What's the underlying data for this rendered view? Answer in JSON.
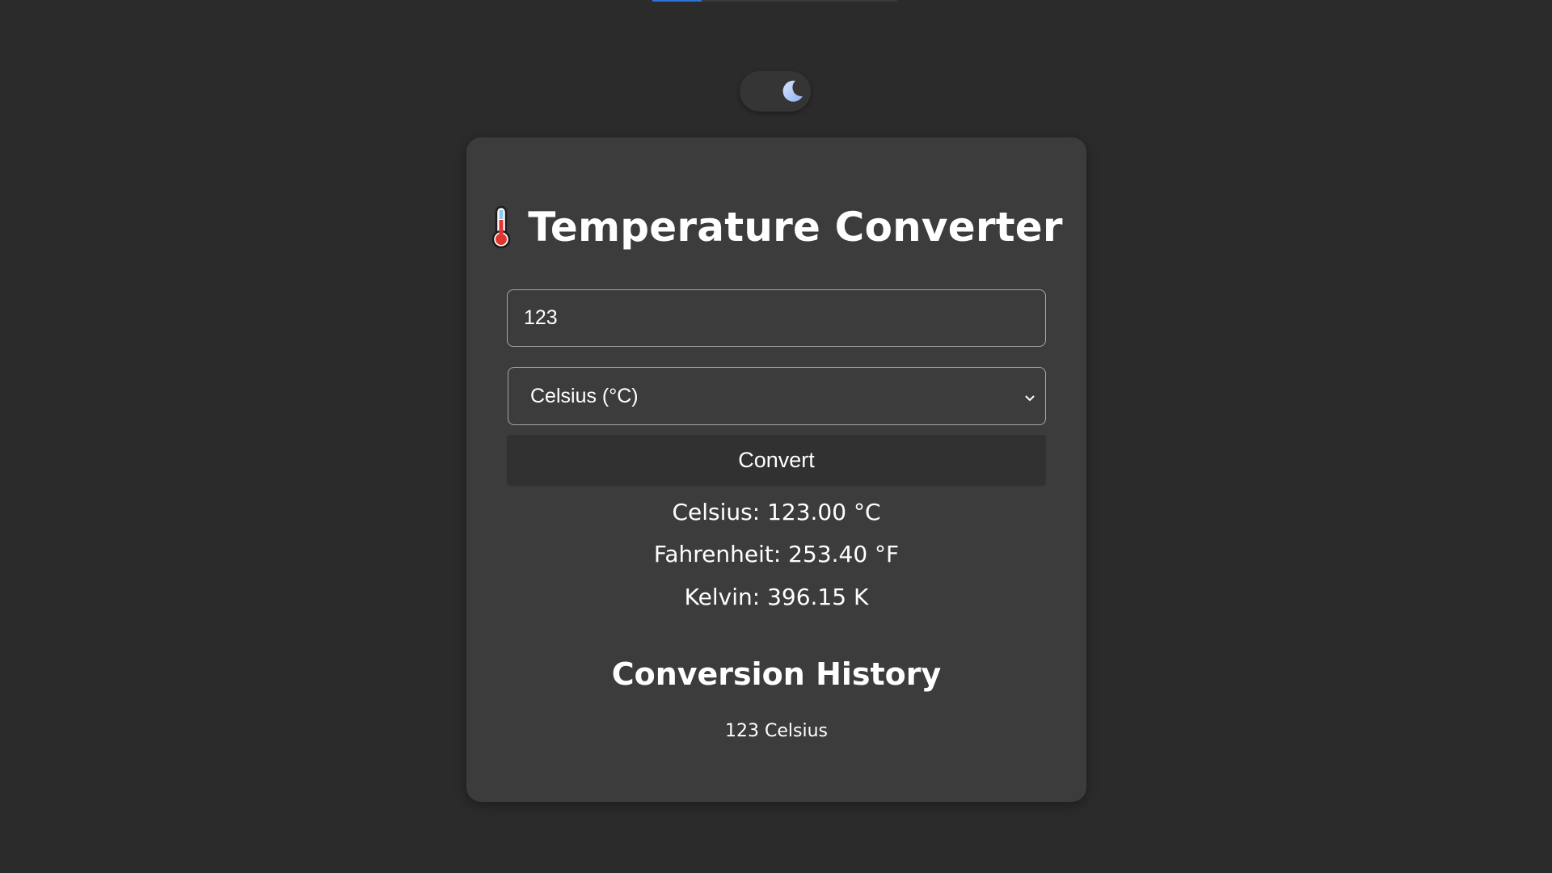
{
  "theme_toggle": {
    "icon": "moon-icon",
    "mode": "dark"
  },
  "top_progress": {
    "fraction": 0.2
  },
  "header": {
    "icon": "thermometer-icon",
    "title": "Temperature Converter"
  },
  "form": {
    "input_value": "123",
    "unit_selected": "Celsius (°C)",
    "convert_label": "Convert"
  },
  "results": {
    "celsius": "Celsius: 123.00 °C",
    "fahrenheit": "Fahrenheit: 253.40 °F",
    "kelvin": "Kelvin: 396.15 K"
  },
  "history": {
    "title": "Conversion History",
    "items": [
      "123 Celsius"
    ]
  },
  "colors": {
    "background": "#2b2b2b",
    "card": "#3c3c3c",
    "button": "#313131",
    "accent": "#2f6fd6"
  }
}
